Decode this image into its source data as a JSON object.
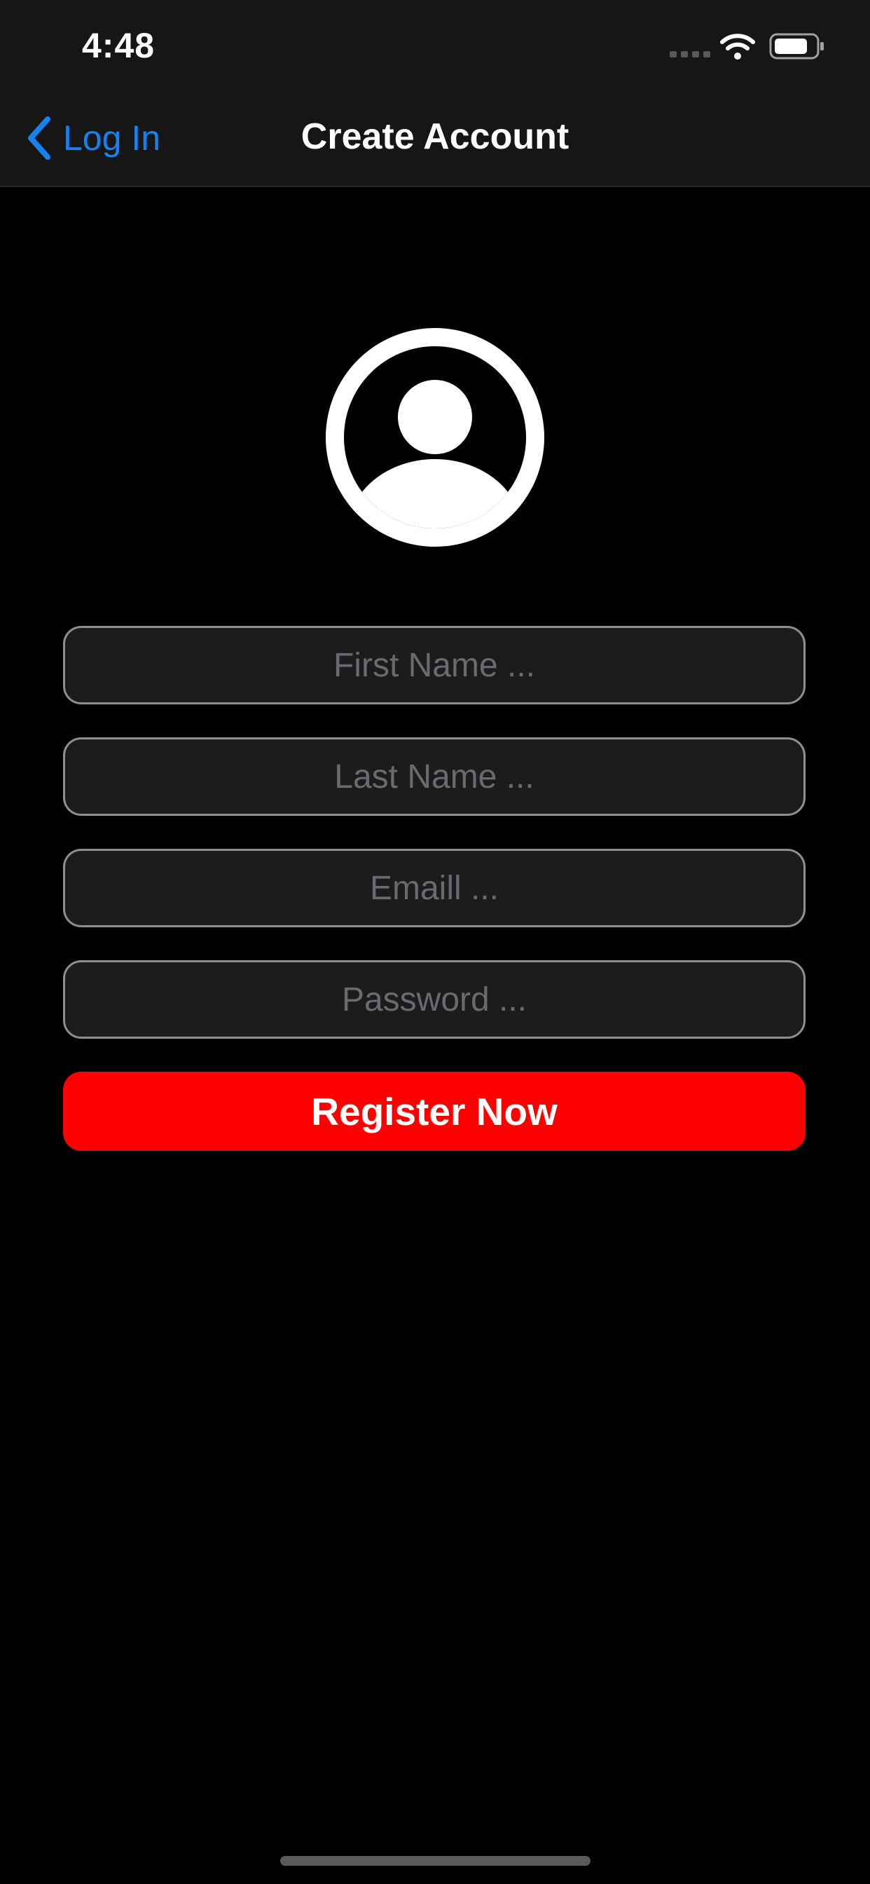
{
  "status_bar": {
    "time": "4:48",
    "icons": [
      "cellular-signal-icon",
      "wifi-icon",
      "battery-icon"
    ]
  },
  "nav": {
    "back_label": "Log In",
    "back_icon": "chevron-left-icon",
    "title": "Create Account"
  },
  "avatar": {
    "icon": "person-circle-icon"
  },
  "form": {
    "first_name": {
      "value": "",
      "placeholder": "First Name ..."
    },
    "last_name": {
      "value": "",
      "placeholder": "Last Name ..."
    },
    "email": {
      "value": "",
      "placeholder": "Emaill ..."
    },
    "password": {
      "value": "",
      "placeholder": "Password ..."
    },
    "submit_label": "Register Now"
  },
  "colors": {
    "background": "#000000",
    "nav_background": "#161616",
    "accent_blue": "#1582f0",
    "button_red": "#ff0000",
    "field_background": "#1c1c1e",
    "field_border": "#8e8e93",
    "placeholder": "#6b6b6f"
  }
}
